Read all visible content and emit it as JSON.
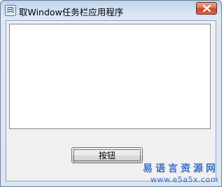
{
  "window": {
    "title": "取Window任务栏应用程序",
    "icon": "app-icon",
    "close_icon": "close-icon"
  },
  "listbox": {
    "items": []
  },
  "button": {
    "label": "按钮"
  },
  "watermark": {
    "title": "易语言资源网",
    "url": "www.e5a5x.com"
  },
  "colors": {
    "title_bar": "#c9dbef",
    "close_button": "#c8452a",
    "client_bg": "#f0f0f0",
    "watermark": "#3a6fc4"
  }
}
